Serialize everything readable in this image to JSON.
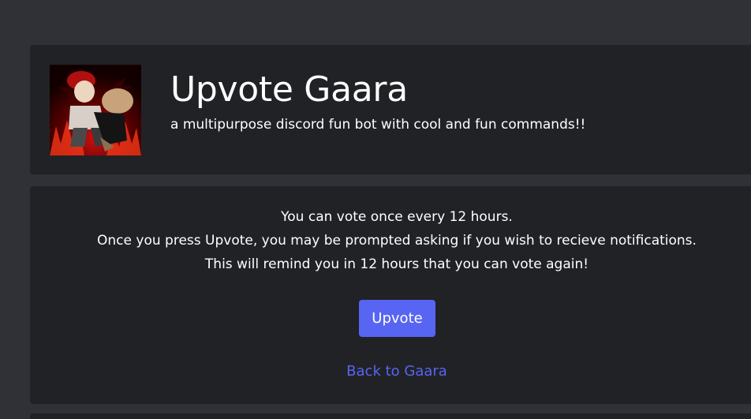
{
  "colors": {
    "page_background": "#2f3136",
    "card_background": "#212226",
    "accent": "#5865f2",
    "text": "#ffffff"
  },
  "bot": {
    "avatar": "bot-avatar-image",
    "title": "Upvote Gaara",
    "description": "a multipurpose discord fun bot with cool and fun commands!!"
  },
  "vote": {
    "info_lines": [
      "You can vote once every 12 hours.",
      "Once you press Upvote, you may be prompted asking if you wish to recieve notifications.",
      "This will remind you in 12 hours that you can vote again!"
    ],
    "button_label": "Upvote",
    "back_link": "Back to Gaara"
  }
}
